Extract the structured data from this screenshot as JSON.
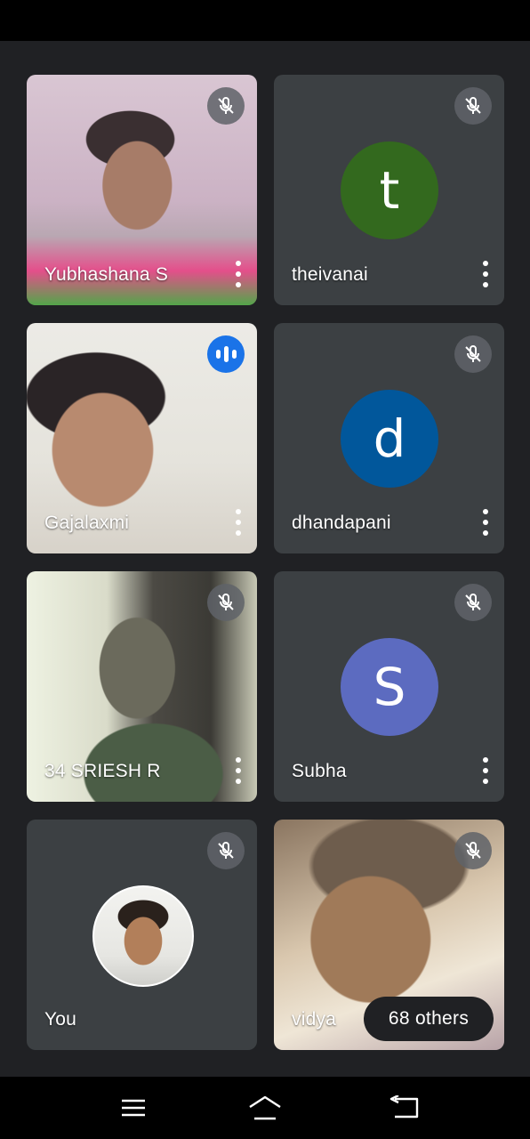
{
  "participants": [
    {
      "name": "Yubhashana S",
      "muted": true,
      "type": "video"
    },
    {
      "name": "theivanai",
      "muted": true,
      "type": "avatar",
      "initial": "t",
      "color": "#33691e"
    },
    {
      "name": "Gajalaxmi",
      "muted": false,
      "speaking": true,
      "type": "video"
    },
    {
      "name": "dhandapani",
      "muted": true,
      "type": "avatar",
      "initial": "d",
      "color": "#01579b"
    },
    {
      "name": "34 SRIESH R",
      "muted": true,
      "type": "video"
    },
    {
      "name": "Subha",
      "muted": true,
      "type": "avatar",
      "initial": "S",
      "color": "#5c6bc0"
    },
    {
      "name": "You",
      "muted": true,
      "type": "photo-avatar"
    },
    {
      "name": "vidya",
      "muted": true,
      "type": "video"
    }
  ],
  "others_label": "68 others",
  "icons": {
    "muted": "mic-off-icon",
    "speaking": "audio-level-icon",
    "more": "more-vert-icon",
    "nav_menu": "menu-icon",
    "nav_home": "home-icon",
    "nav_back": "back-icon"
  }
}
